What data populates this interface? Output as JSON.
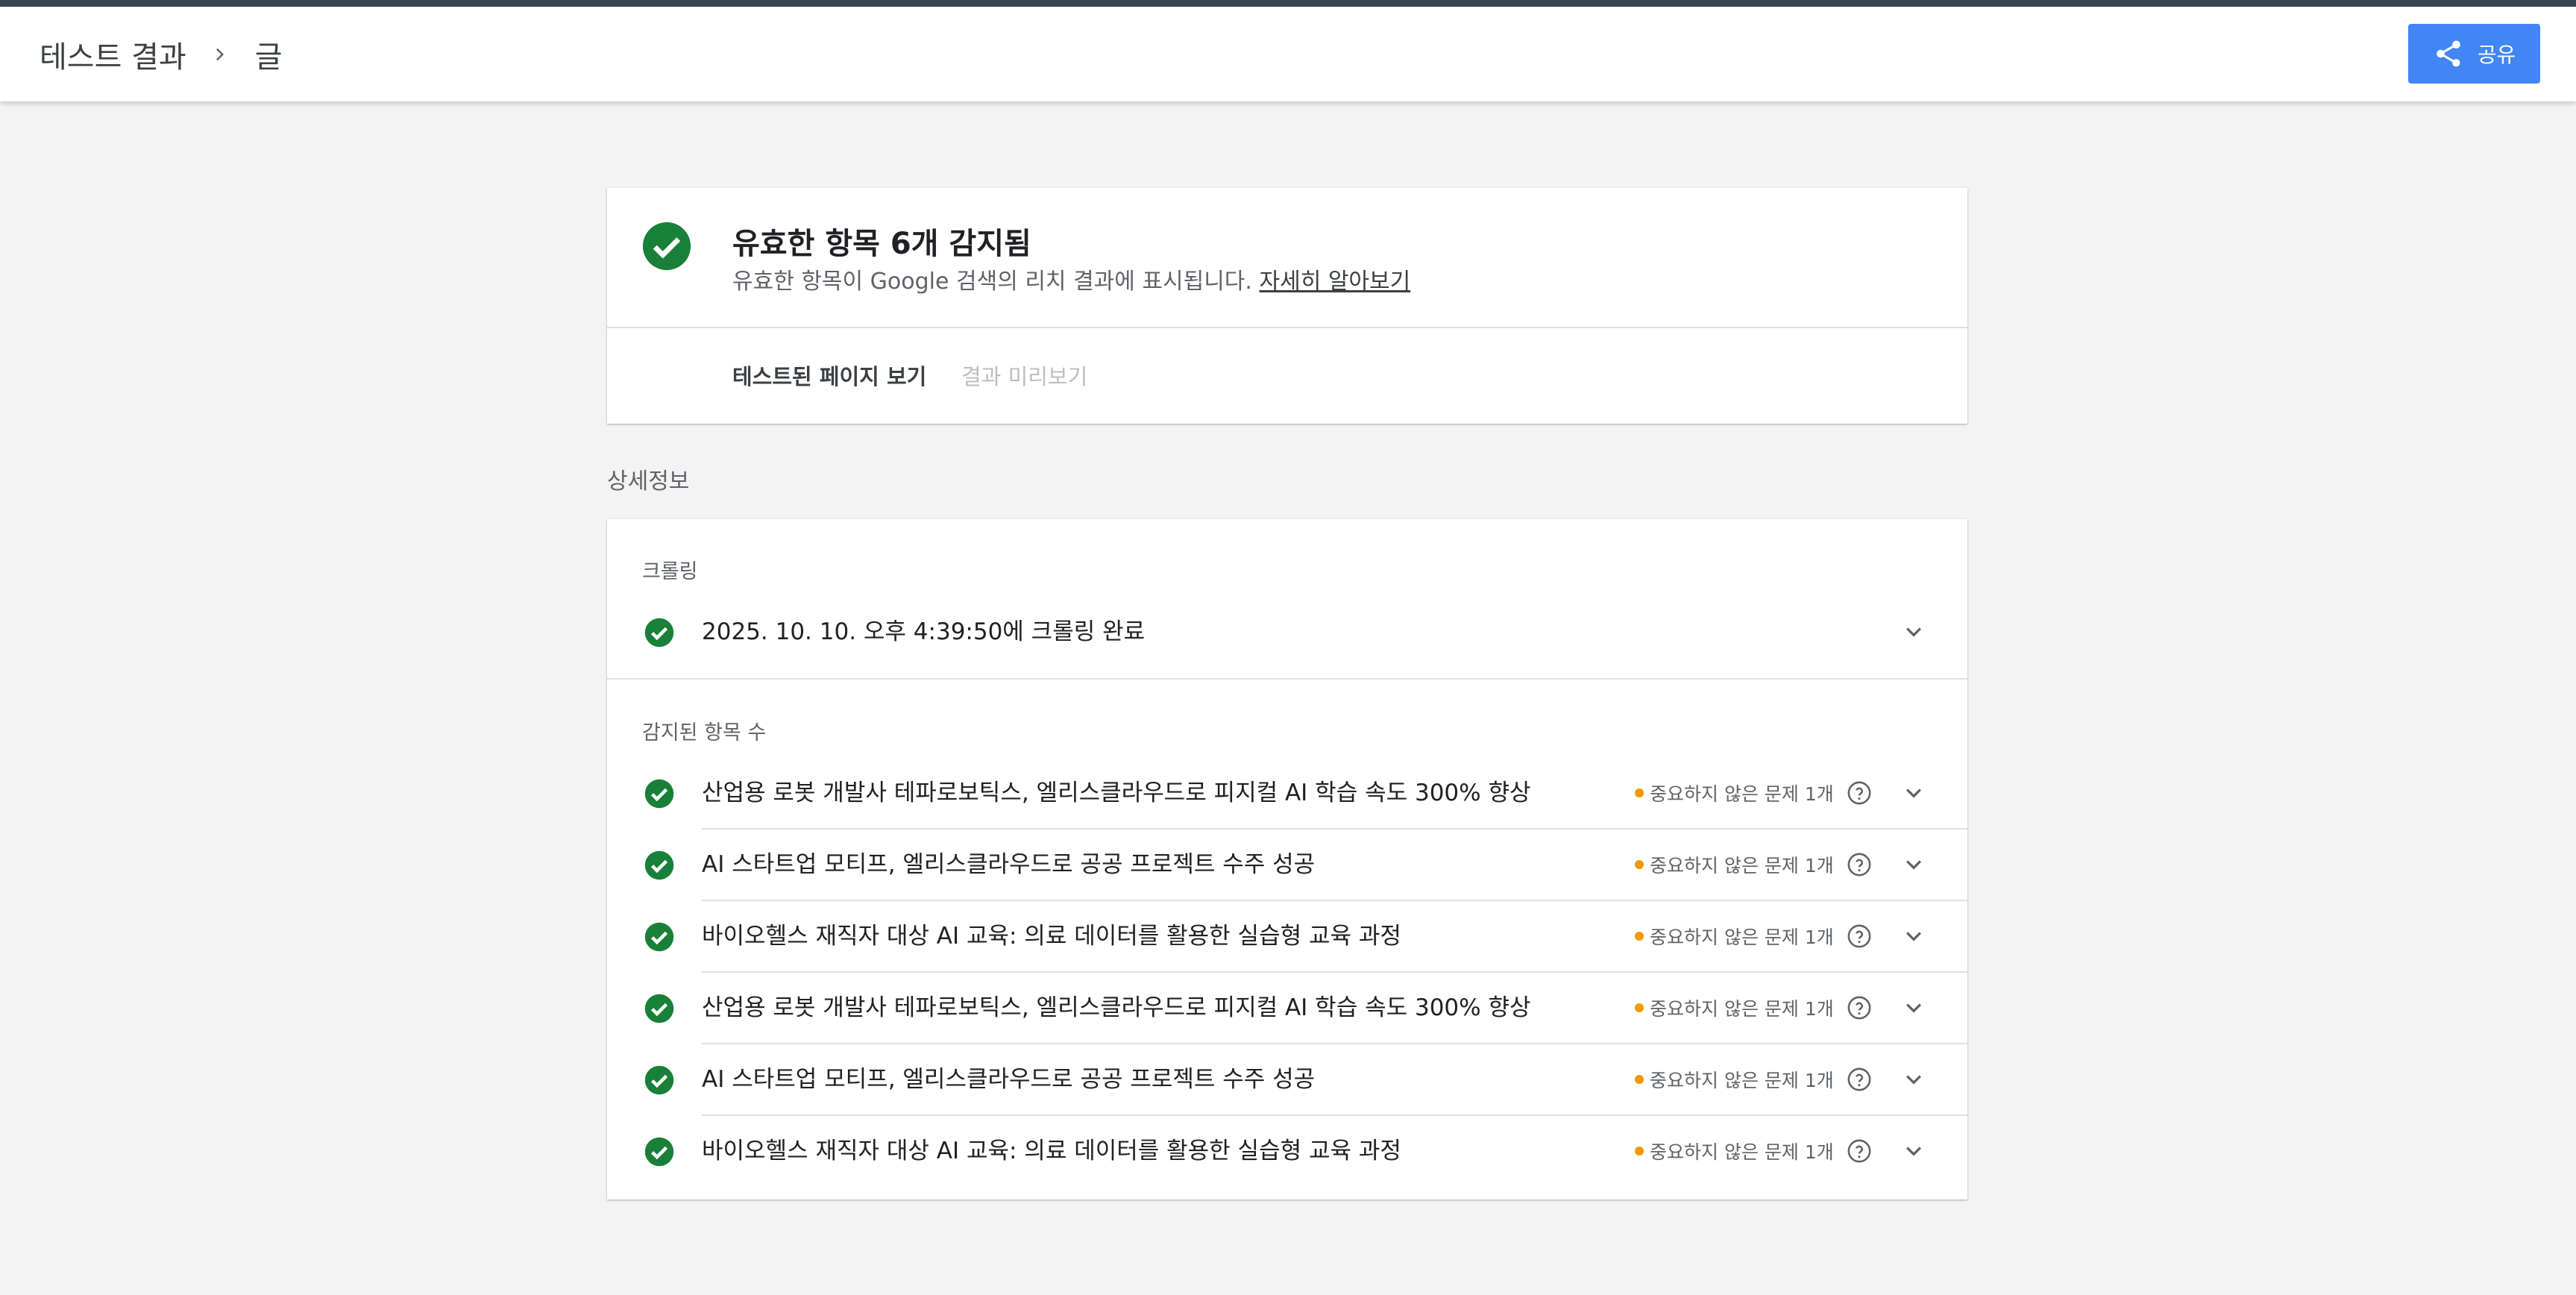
{
  "header": {
    "breadcrumb_root": "테스트 결과",
    "breadcrumb_current": "글",
    "share_label": "공유"
  },
  "summary": {
    "title": "유효한 항목 6개 감지됨",
    "subtitle": "유효한 항목이 Google 검색의 리치 결과에 표시됩니다.",
    "learn_more": "자세히 알아보기",
    "tabs": [
      {
        "label": "테스트된 페이지 보기",
        "active": true
      },
      {
        "label": "결과 미리보기",
        "active": false
      }
    ]
  },
  "details": {
    "heading": "상세정보",
    "crawl": {
      "label": "크롤링",
      "status": "2025. 10. 10. 오후 4:39:50에 크롤링 완료"
    },
    "detected": {
      "label": "감지된 항목 수",
      "items": [
        {
          "title": "산업용 로봇 개발사 테파로보틱스, 엘리스클라우드로 피지컬 AI 학습 속도 300% 향상",
          "issue": "중요하지 않은 문제 1개"
        },
        {
          "title": "AI 스타트업 모티프, 엘리스클라우드로 공공 프로젝트 수주 성공",
          "issue": "중요하지 않은 문제 1개"
        },
        {
          "title": "바이오헬스 재직자 대상 AI 교육: 의료 데이터를 활용한 실습형 교육 과정",
          "issue": "중요하지 않은 문제 1개"
        },
        {
          "title": "산업용 로봇 개발사 테파로보틱스, 엘리스클라우드로 피지컬 AI 학습 속도 300% 향상",
          "issue": "중요하지 않은 문제 1개"
        },
        {
          "title": "AI 스타트업 모티프, 엘리스클라우드로 공공 프로젝트 수주 성공",
          "issue": "중요하지 않은 문제 1개"
        },
        {
          "title": "바이오헬스 재직자 대상 AI 교육: 의료 데이터를 활용한 실습형 교육 과정",
          "issue": "중요하지 않은 문제 1개"
        }
      ]
    }
  },
  "colors": {
    "success": "#188038",
    "warning": "#f29900",
    "accent": "#4285f4",
    "topline": "#37474f"
  },
  "icons": {
    "share": "share-icon",
    "check": "check-circle-icon",
    "help": "help-icon",
    "expand": "chevron-down-icon",
    "breadcrumb_separator": "chevron-right-icon"
  }
}
